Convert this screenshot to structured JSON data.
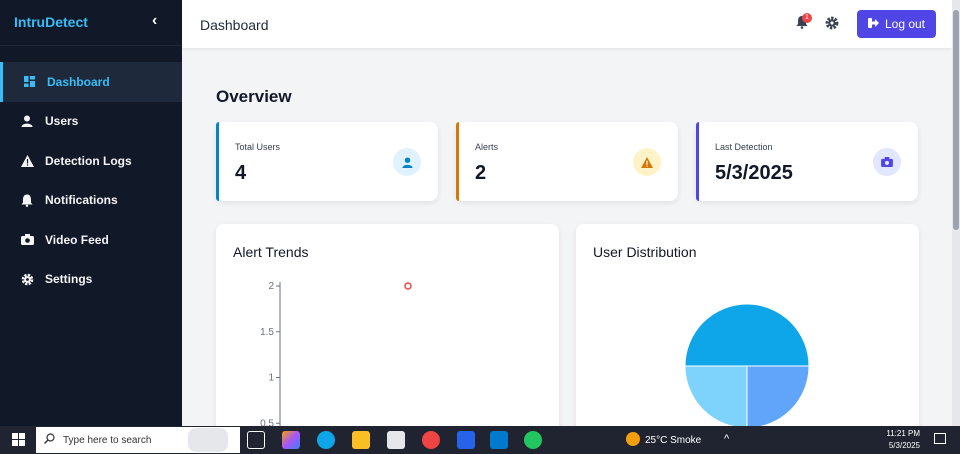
{
  "sidebar": {
    "brand": "IntruDetect",
    "collapse_icon": "chevron-left-icon",
    "items": [
      {
        "label": "Dashboard",
        "icon": "dashboard-icon",
        "active": true
      },
      {
        "label": "Users",
        "icon": "user-icon"
      },
      {
        "label": "Detection Logs",
        "icon": "warning-icon"
      },
      {
        "label": "Notifications",
        "icon": "bell-icon"
      },
      {
        "label": "Video Feed",
        "icon": "camera-icon"
      },
      {
        "label": "Settings",
        "icon": "gear-icon"
      }
    ]
  },
  "header": {
    "title": "Dashboard",
    "notification_count": "1",
    "logout_label": "Log out"
  },
  "main": {
    "overview_title": "Overview",
    "cards": [
      {
        "label": "Total Users",
        "value": "4",
        "color": "#0284c7",
        "icon": "user-icon"
      },
      {
        "label": "Alerts",
        "value": "2",
        "color": "#d97706",
        "icon": "warning-icon"
      },
      {
        "label": "Last Detection",
        "value": "5/3/2025",
        "color": "#4f46e5",
        "icon": "camera-icon"
      }
    ],
    "alert_trends": {
      "title": "Alert Trends"
    },
    "user_distribution": {
      "title": "User Distribution"
    }
  },
  "chart_data": [
    {
      "type": "line",
      "title": "Alert Trends",
      "y_ticks": [
        "2",
        "1.5",
        "1",
        "0.5"
      ],
      "ylim": [
        0,
        2
      ],
      "series": [
        {
          "values": [
            2
          ]
        }
      ]
    },
    {
      "type": "pie",
      "title": "User Distribution",
      "colors": [
        "#0ea5e9",
        "#7dd3fc",
        "#60a5fa"
      ]
    }
  ],
  "taskbar": {
    "search_placeholder": "Type here to search",
    "weather": "25°C  Smoke",
    "time": "11:21 PM",
    "date": "5/3/2025"
  }
}
